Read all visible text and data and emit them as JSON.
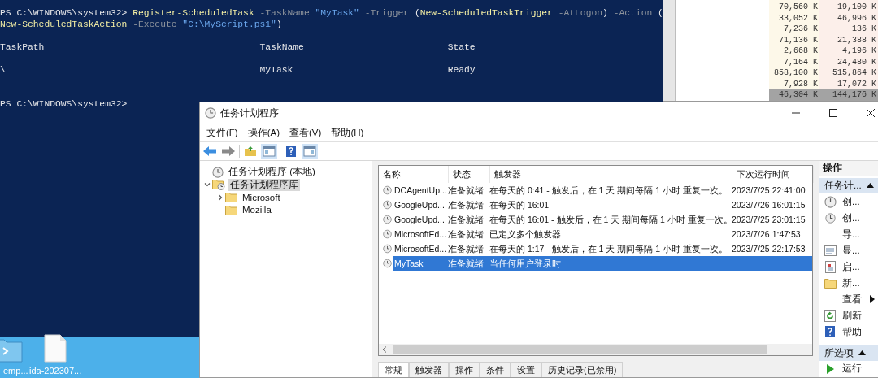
{
  "powershell": {
    "command_lines": [
      [
        {
          "text": "PS C:\\WINDOWS\\system32> ",
          "kind": "plain"
        },
        {
          "text": "Register-ScheduledTask",
          "kind": "command"
        },
        {
          "text": " -TaskName",
          "kind": "param"
        },
        {
          "text": " \"MyTask\"",
          "kind": "string"
        },
        {
          "text": " -Trigger",
          "kind": "param"
        },
        {
          "text": " (",
          "kind": "plain"
        },
        {
          "text": "New-ScheduledTaskTrigger",
          "kind": "command"
        },
        {
          "text": " -AtLogon",
          "kind": "param"
        },
        {
          "text": ") ",
          "kind": "plain"
        },
        {
          "text": "-Action",
          "kind": "param"
        },
        {
          "text": " (",
          "kind": "plain"
        }
      ],
      [
        {
          "text": "New-ScheduledTaskAction",
          "kind": "command"
        },
        {
          "text": " -Execute",
          "kind": "param"
        },
        {
          "text": " \"C:\\MyScript.ps1\"",
          "kind": "string"
        },
        {
          "text": ")",
          "kind": "plain"
        }
      ]
    ],
    "table": {
      "columns": [
        {
          "heading": "TaskPath",
          "underline": "--------"
        },
        {
          "heading": "TaskName",
          "underline": "--------"
        },
        {
          "heading": "State",
          "underline": "-----"
        }
      ],
      "rows": [
        [
          "\\",
          "MyTask",
          "Ready"
        ]
      ]
    },
    "prompt": "PS C:\\WINDOWS\\system32>"
  },
  "task_manager": {
    "rows": [
      {
        "column_1": "70,560 K",
        "column_2": "19,100 K",
        "selected": false
      },
      {
        "column_1": "33,052 K",
        "column_2": "46,996 K",
        "selected": false
      },
      {
        "column_1": "7,236 K",
        "column_2": "136 K",
        "selected": false
      },
      {
        "column_1": "71,136 K",
        "column_2": "21,388 K",
        "selected": false
      },
      {
        "column_1": "2,668 K",
        "column_2": "4,196 K",
        "selected": false
      },
      {
        "column_1": "7,164 K",
        "column_2": "24,480 K",
        "selected": false
      },
      {
        "column_1": "858,100 K",
        "column_2": "515,864 K",
        "selected": false
      },
      {
        "column_1": "7,928 K",
        "column_2": "17,072 K",
        "selected": false
      },
      {
        "column_1": "46,304 K",
        "column_2": "144,176 K",
        "selected": true
      }
    ]
  },
  "scheduler": {
    "title": "任务计划程序",
    "menu": [
      "文件(F)",
      "操作(A)",
      "查看(V)",
      "帮助(H)"
    ],
    "toolbar_buttons": [
      {
        "pressed": false
      },
      {
        "pressed": false
      },
      {
        "pressed": false
      },
      {
        "pressed": true
      },
      {
        "pressed": false
      },
      {
        "pressed": true
      }
    ],
    "tree": [
      {
        "label": "任务计划程序 (本地)",
        "selected": false
      },
      {
        "label": "任务计划程序库",
        "selected": true,
        "expanded": true,
        "children": [
          {
            "label": "Microsoft",
            "selected": false,
            "expanded": false
          },
          {
            "label": "Mozilla",
            "selected": false
          }
        ]
      }
    ],
    "columns": [
      "名称",
      "状态",
      "触发器",
      "下次运行时间"
    ],
    "rows": [
      {
        "cells": [
          "DCAgentUp...",
          "准备就绪",
          "在每天的 0:41 - 触发后，在 1 天 期间每隔 1 小时 重复一次。",
          "2023/7/25 22:41:00"
        ],
        "selected": false
      },
      {
        "cells": [
          "GoogleUpd...",
          "准备就绪",
          "在每天的 16:01",
          "2023/7/26 16:01:15"
        ],
        "selected": false
      },
      {
        "cells": [
          "GoogleUpd...",
          "准备就绪",
          "在每天的 16:01 - 触发后，在 1 天 期间每隔 1 小时 重复一次。",
          "2023/7/25 23:01:15"
        ],
        "selected": false
      },
      {
        "cells": [
          "MicrosoftEd...",
          "准备就绪",
          "已定义多个触发器",
          "2023/7/26 1:47:53"
        ],
        "selected": false
      },
      {
        "cells": [
          "MicrosoftEd...",
          "准备就绪",
          "在每天的 1:17 - 触发后，在 1 天 期间每隔 1 小时 重复一次。",
          "2023/7/25 22:17:53"
        ],
        "selected": false
      },
      {
        "cells": [
          "MyTask",
          "准备就绪",
          "当任何用户登录时"
        ],
        "selected": true
      }
    ],
    "tabs": [
      {
        "label": "常规",
        "selected": true
      },
      {
        "label": "触发器",
        "selected": false
      },
      {
        "label": "操作",
        "selected": false
      },
      {
        "label": "条件",
        "selected": false
      },
      {
        "label": "设置",
        "selected": false
      },
      {
        "label": "历史记录(已禁用)",
        "selected": false
      }
    ],
    "actions": {
      "title": "操作",
      "sections": [
        {
          "title": "任务计...",
          "expanded": true,
          "items": [
            {
              "label": "创...",
              "kind": "command"
            },
            {
              "label": "创...",
              "kind": "command"
            },
            {
              "label": "导...",
              "kind": "command"
            },
            {
              "label": "显...",
              "kind": "command"
            },
            {
              "label": "启...",
              "kind": "command"
            },
            {
              "label": "新...",
              "kind": "command"
            },
            {
              "label": "查看",
              "kind": "submenu"
            },
            {
              "label": "刷新",
              "kind": "command"
            },
            {
              "label": "帮助",
              "kind": "command"
            }
          ]
        },
        {
          "title": "所选项",
          "expanded": true,
          "items": [
            {
              "label": "运行",
              "kind": "command"
            }
          ]
        }
      ]
    }
  },
  "desktop_icons": [
    {
      "label": "emp..."
    },
    {
      "label": "ida-202307..."
    }
  ]
}
